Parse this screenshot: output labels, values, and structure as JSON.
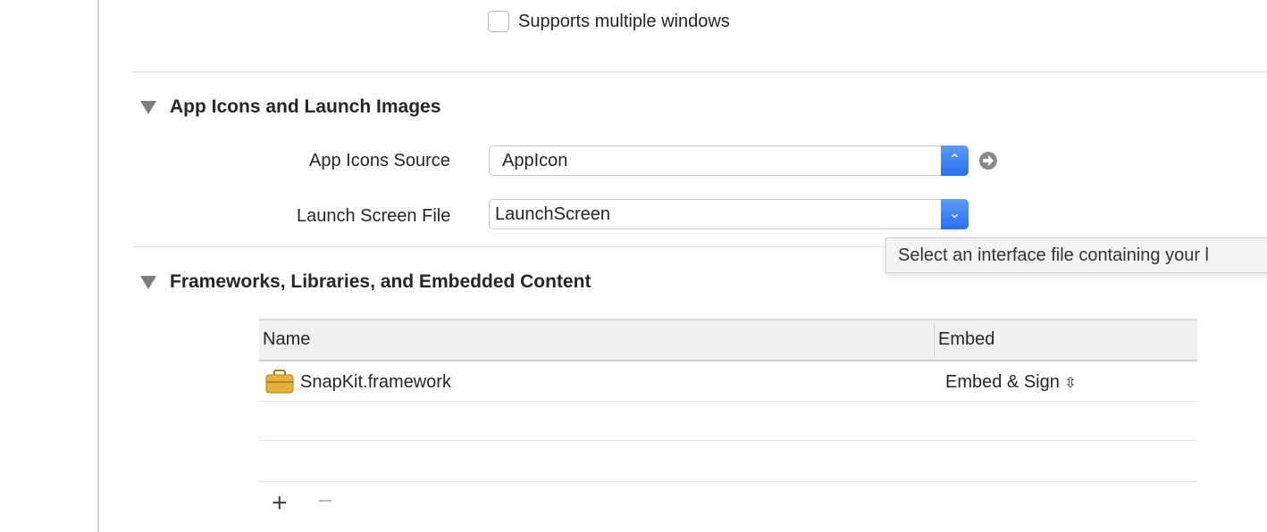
{
  "deployment": {
    "supports_multiple_windows": {
      "label": "Supports multiple windows",
      "checked": false
    }
  },
  "app_icons": {
    "title": "App Icons and Launch Images",
    "app_icons_source": {
      "label": "App Icons Source",
      "value": "AppIcon"
    },
    "launch_screen_file": {
      "label": "Launch Screen File",
      "value": "LaunchScreen"
    },
    "tooltip": "Select an interface file containing your l"
  },
  "frameworks": {
    "title": "Frameworks, Libraries, and Embedded Content",
    "columns": [
      "Name",
      "Embed"
    ],
    "rows": [
      {
        "name": "SnapKit.framework",
        "embed": "Embed & Sign",
        "icon": "toolbox-icon"
      }
    ],
    "add": "+",
    "remove": "−"
  },
  "colors": {
    "accent": "#2a6ff0"
  }
}
